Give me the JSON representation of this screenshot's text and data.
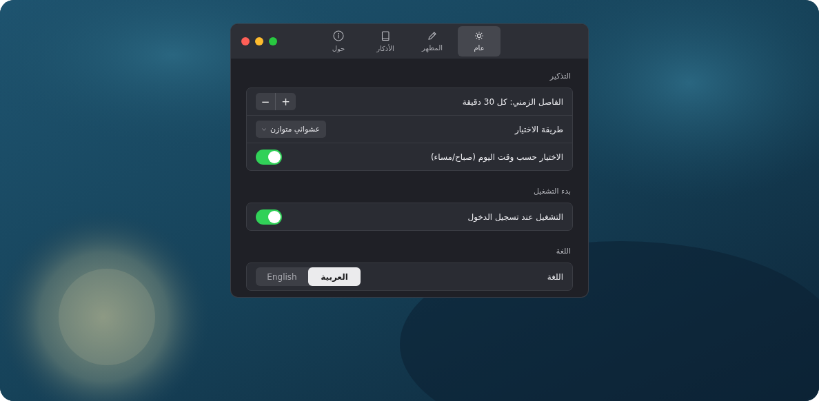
{
  "tabs": [
    {
      "kind": "general",
      "label": "عام",
      "selected": true
    },
    {
      "kind": "appearance",
      "label": "المظهر",
      "selected": false
    },
    {
      "kind": "adhkar",
      "label": "الأذكار",
      "selected": false
    },
    {
      "kind": "about",
      "label": "حول",
      "selected": false
    }
  ],
  "sections": [
    {
      "title": "التذكير",
      "rows": [
        {
          "kind": "stepper",
          "label": "الفاصل الزمني: كل 30 دقيقة",
          "buttons": [
            "+",
            "−"
          ]
        },
        {
          "kind": "dropdown",
          "label": "طريقة الاختيار",
          "value": "عشوائي متوازن"
        },
        {
          "kind": "toggle",
          "label": "الاختيار حسب وقت اليوم (صباح/مساء)",
          "on": true
        }
      ]
    },
    {
      "title": "بدء التشغيل",
      "rows": [
        {
          "kind": "toggle",
          "label": "التشغيل عند تسجيل الدخول",
          "on": true
        }
      ]
    },
    {
      "title": "اللغة",
      "rows": [
        {
          "kind": "segmented",
          "label": "اللغة",
          "options": [
            {
              "label": "العربية",
              "selected": true
            },
            {
              "label": "English",
              "selected": false
            }
          ]
        }
      ]
    }
  ]
}
